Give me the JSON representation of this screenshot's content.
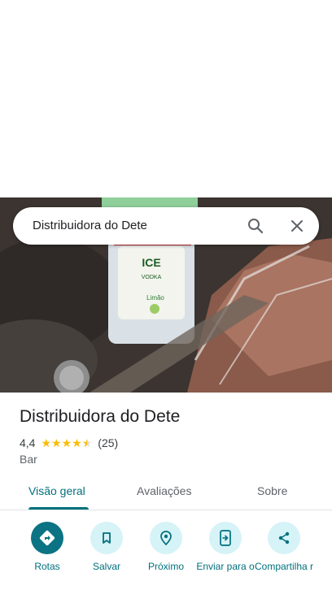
{
  "search": {
    "query": "Distribuidora do Dete"
  },
  "place": {
    "title": "Distribuidora do Dete",
    "rating": "4,4",
    "stars": 4.4,
    "review_count": "(25)",
    "category": "Bar"
  },
  "tabs": [
    {
      "label": "Visão geral",
      "active": true
    },
    {
      "label": "Avaliações",
      "active": false
    },
    {
      "label": "Sobre",
      "active": false
    }
  ],
  "actions": [
    {
      "label": "Rotas",
      "icon": "directions-icon"
    },
    {
      "label": "Salvar",
      "icon": "bookmark-icon"
    },
    {
      "label": "Próximo",
      "icon": "nearby-icon"
    },
    {
      "label": "Enviar para o",
      "icon": "send-to-phone-icon"
    },
    {
      "label": "Compartilha r",
      "icon": "share-icon"
    }
  ],
  "colors": {
    "accent": "#00707d",
    "primary_button": "#0b7383",
    "action_bg": "#d6f3f7",
    "star": "#fbbc04"
  }
}
